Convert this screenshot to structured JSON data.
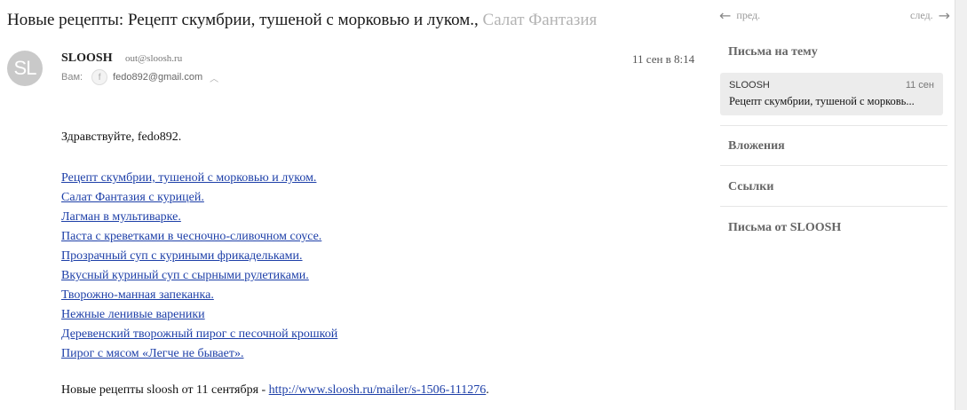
{
  "email": {
    "subject": "Новые рецепты: Рецепт скумбрии, тушеной с морковью и луком., Салат Фантазия",
    "subject_main": "Новые рецепты: Рецепт скумбрии, тушеной с морковью и луком.,",
    "subject_fade": " Салат Фантазия",
    "sender_name": "SLOOSH",
    "sender_email": "out@sloosh.ru",
    "avatar_initials": "SL",
    "date": "11 сен в 8:14",
    "to_label": "Вам:",
    "to_avatar": "f",
    "to_email": "fedo892@gmail.com",
    "greeting": "Здравствуйте, fedo892.",
    "links": [
      "Рецепт скумбрии, тушеной с морковью и луком.",
      "Салат Фантазия с курицей.",
      "Лагман в мультиварке.",
      "Паста с креветками в чесночно-сливочном соусе.",
      "Прозрачный суп с куриными фрикадельками.",
      "Вкусный куриный суп с сырными рулетиками.",
      "Творожно-манная запеканка.",
      "Нежные ленивые вареники",
      "Деревенский творожный пирог с песочной крошкой",
      "Пирог с мясом «Легче не бывает»."
    ],
    "footer_text": "Новые рецепты sloosh от 11 сентября - ",
    "footer_link": "http://www.sloosh.ru/mailer/s-1506-111276",
    "footer_end": "."
  },
  "sidebar": {
    "prev_label": "пред.",
    "next_label": "след.",
    "thread_title": "Письма на тему",
    "thread_item": {
      "sender": "SLOOSH",
      "date": "11 сен",
      "subject": "Рецепт скумбрии, тушеной с морковь..."
    },
    "attachments_title": "Вложения",
    "links_title": "Ссылки",
    "from_title": "Письма от SLOOSH"
  },
  "icons": {
    "prev": "arrow-left-icon",
    "next": "arrow-right-icon",
    "expand": "chevron-up-icon"
  }
}
